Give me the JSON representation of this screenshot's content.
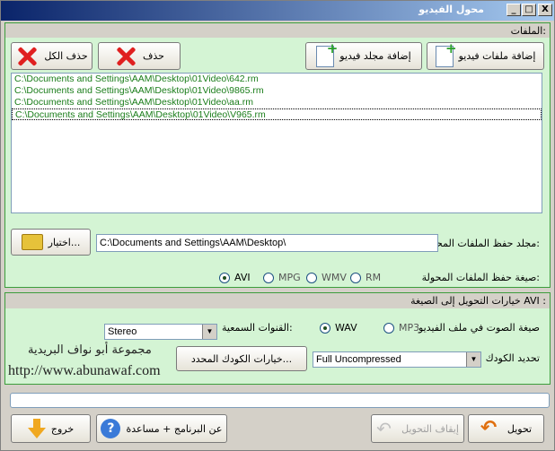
{
  "window": {
    "title": "محول الفيديو",
    "min": "_",
    "max": "□",
    "close": "X"
  },
  "files": {
    "group_label": "الملفات:",
    "add_files": "إضافة ملفات فيديو",
    "add_folder": "إضافة مجلد فيديو",
    "delete": "حذف",
    "delete_all": "حذف الكل",
    "items": [
      "C:\\Documents and Settings\\AAM\\Desktop\\01Video\\642.rm",
      "C:\\Documents and Settings\\AAM\\Desktop\\01Video\\9865.rm",
      "C:\\Documents and Settings\\AAM\\Desktop\\01Video\\aa.rm",
      "C:\\Documents and Settings\\AAM\\Desktop\\01Video\\V965.rm"
    ],
    "save_folder_label": "مجلد حفظ الملفات المحولة:",
    "save_folder_value": "C:\\Documents and Settings\\AAM\\Desktop\\",
    "browse": "اختيار...",
    "format_label": "صيغة حفظ الملفات المحولة:",
    "formats": [
      "AVI",
      "MPG",
      "WMV",
      "RM"
    ],
    "selected_format": "AVI"
  },
  "options": {
    "group_label": "خيارات التحويل إلى الصيغة AVI :",
    "audio_label": "صيغة الصوت في ملف الفيديو",
    "audio_formats": [
      "MP3",
      "WAV"
    ],
    "selected_audio": "WAV",
    "channels_label": "القنوات السمعية:",
    "channels_value": "Stereo",
    "codec_label": "تحديد الكودك",
    "codec_value": "Full Uncompressed",
    "codec_options_button": "خيارات الكودك المحدد...",
    "brand_line1": "مجموعة أبو نواف البريدية",
    "brand_line2": "http://www.abunawaf.com"
  },
  "progress": {
    "value": 0
  },
  "footer": {
    "exit": "خروج",
    "about": "عن البرنامج + مساعدة",
    "stop": "إيقاف التحويل",
    "convert": "تحويل"
  }
}
